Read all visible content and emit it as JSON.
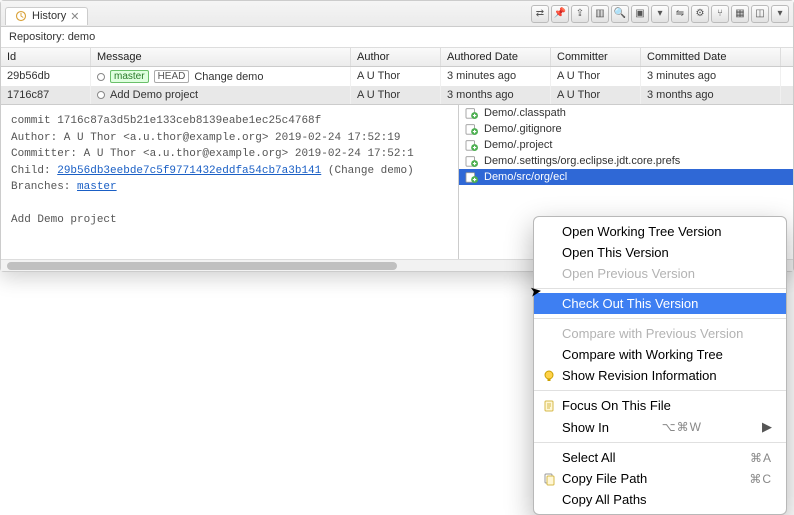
{
  "tab": {
    "title": "History",
    "close": "✕"
  },
  "repo_label": "Repository: demo",
  "columns": {
    "id": "Id",
    "message": "Message",
    "author": "Author",
    "authored": "Authored Date",
    "committer": "Committer",
    "committed": "Committed Date"
  },
  "rows": [
    {
      "id": "29b56db",
      "badges": [
        "master",
        "HEAD"
      ],
      "msg": "Change demo",
      "author": "A U Thor",
      "authored": "3 minutes ago",
      "committer": "A U Thor",
      "committed": "3 minutes ago",
      "selected": false
    },
    {
      "id": "1716c87",
      "badges": [],
      "msg": "Add Demo project",
      "author": "A U Thor",
      "authored": "3 months ago",
      "committer": "A U Thor",
      "committed": "3 months ago",
      "selected": true
    }
  ],
  "detail": {
    "commit_line": "commit 1716c87a3d5b21e133ceb8139eabe1ec25c4768f",
    "author_line": "Author: A U Thor <a.u.thor@example.org> 2019-02-24 17:52:19",
    "committer_line": "Committer: A U Thor <a.u.thor@example.org> 2019-02-24 17:52:1",
    "child_prefix": "Child: ",
    "child_link": "29b56db3eebde7c5f9771432eddfa54cb7a3b141",
    "child_suffix": " (Change demo)",
    "branches_prefix": "Branches: ",
    "branches_link": "master",
    "body": "Add Demo project"
  },
  "files": [
    {
      "path": "Demo/.classpath"
    },
    {
      "path": "Demo/.gitignore"
    },
    {
      "path": "Demo/.project"
    },
    {
      "path": "Demo/.settings/org.eclipse.jdt.core.prefs"
    },
    {
      "path": "Demo/src/org/ecl",
      "selected": true
    }
  ],
  "context_menu": [
    {
      "label": "Open Working Tree Version"
    },
    {
      "label": "Open This Version"
    },
    {
      "label": "Open Previous Version",
      "disabled": true
    },
    {
      "sep": true
    },
    {
      "label": "Check Out This Version",
      "highlight": true
    },
    {
      "sep": true
    },
    {
      "label": "Compare with Previous Version",
      "disabled": true
    },
    {
      "label": "Compare with Working Tree"
    },
    {
      "label": "Show Revision Information",
      "icon": "bulb"
    },
    {
      "sep": true
    },
    {
      "label": "Focus On This File",
      "icon": "page"
    },
    {
      "label": "Show In",
      "accel": "⌥⌘W",
      "submenu": true
    },
    {
      "sep": true
    },
    {
      "label": "Select All",
      "accel": "⌘A"
    },
    {
      "label": "Copy File Path",
      "icon": "copy",
      "accel": "⌘C"
    },
    {
      "label": "Copy All Paths"
    }
  ],
  "toolbar_icons": [
    "link",
    "pin",
    "export",
    "columns",
    "search",
    "filter",
    "dropdown",
    "compare",
    "tree",
    "branch",
    "layout1",
    "layout2",
    "min"
  ]
}
